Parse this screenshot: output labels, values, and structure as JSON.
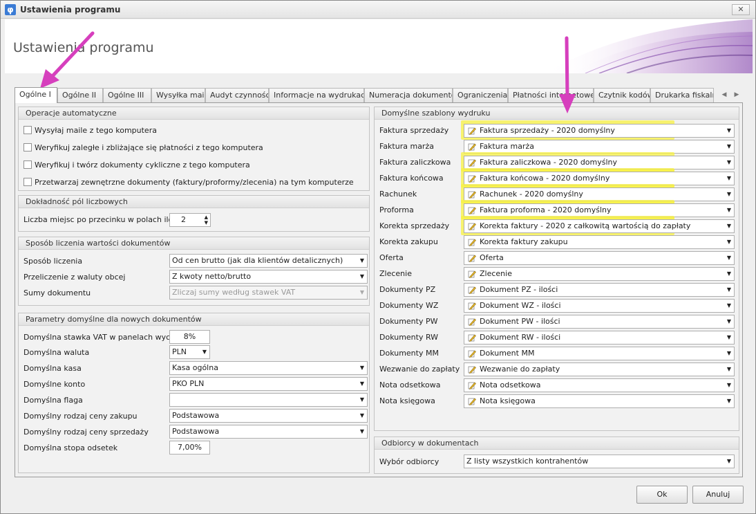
{
  "window": {
    "title": "Ustawienia programu",
    "close": "✕"
  },
  "header": {
    "title": "Ustawienia programu"
  },
  "tabs": [
    "Ogólne I",
    "Ogólne II",
    "Ogólne III",
    "Wysyłka maili",
    "Audyt czynności",
    "Informacje na wydrukach",
    "Numeracja dokumentów",
    "Ograniczenia",
    "Płatności internetowe",
    "Czytnik kodów",
    "Drukarka fiskaln"
  ],
  "active_tab": "Ogólne I",
  "auto_ops": {
    "title": "Operacje automatyczne",
    "items": [
      {
        "label": "Wysyłaj maile z tego komputera",
        "checked": false
      },
      {
        "label": "Weryfikuj zaległe i zbliżające się płatności z tego komputera",
        "checked": false
      },
      {
        "label": "Weryfikuj i twórz dokumenty cykliczne z tego komputera",
        "checked": false
      },
      {
        "label": "Przetwarzaj zewnętrzne dokumenty (faktury/proformy/zlecenia) na tym komputerze",
        "checked": false
      }
    ]
  },
  "precision": {
    "title": "Dokładność pól liczbowych",
    "label": "Liczba miejsc po przecinku w polach ilości",
    "value": "2"
  },
  "calc": {
    "title": "Sposób liczenia wartości dokumentów",
    "rows": [
      {
        "label": "Sposób liczenia",
        "value": "Od cen brutto (jak dla klientów detalicznych)",
        "disabled": false
      },
      {
        "label": "Przeliczenie z waluty obcej",
        "value": "Z kwoty netto/brutto",
        "disabled": false
      },
      {
        "label": "Sumy dokumentu",
        "value": "Zliczaj sumy według stawek VAT",
        "disabled": true
      }
    ]
  },
  "defaults": {
    "title": "Parametry domyślne dla nowych dokumentów",
    "vat_label": "Domyślna stawka VAT w panelach wycen",
    "vat_value": "8%",
    "currency_label": "Domyślna waluta",
    "currency_value": "PLN",
    "cashbox_label": "Domyślna kasa",
    "cashbox_value": "Kasa ogólna",
    "account_label": "Domyślne konto",
    "account_value": "PKO PLN",
    "flag_label": "Domyślna flaga",
    "flag_value": "",
    "purchase_price_label": "Domyślny rodzaj ceny zakupu",
    "purchase_price_value": "Podstawowa",
    "sale_price_label": "Domyślny rodzaj ceny sprzedaży",
    "sale_price_value": "Podstawowa",
    "interest_label": "Domyślna stopa odsetek",
    "interest_value": "7,00%"
  },
  "templates": {
    "title": "Domyślne szablony wydruku",
    "rows": [
      {
        "label": "Faktura sprzedaży",
        "value": "Faktura sprzedaży - 2020 domyślny",
        "highlight": true
      },
      {
        "label": "Faktura marża",
        "value": "Faktura marża",
        "highlight": false
      },
      {
        "label": "Faktura zaliczkowa",
        "value": "Faktura zaliczkowa - 2020 domyślny",
        "highlight": true
      },
      {
        "label": "Faktura końcowa",
        "value": "Faktura końcowa - 2020 domyślny",
        "highlight": true
      },
      {
        "label": "Rachunek",
        "value": "Rachunek - 2020 domyślny",
        "highlight": true
      },
      {
        "label": "Proforma",
        "value": "Faktura proforma - 2020 domyślny",
        "highlight": true
      },
      {
        "label": "Korekta sprzedaży",
        "value": "Korekta faktury - 2020 z całkowitą wartością do zapłaty",
        "highlight": true
      },
      {
        "label": "Korekta zakupu",
        "value": "Korekta faktury zakupu",
        "highlight": false
      },
      {
        "label": "Oferta",
        "value": "Oferta",
        "highlight": false
      },
      {
        "label": "Zlecenie",
        "value": "Zlecenie",
        "highlight": false
      },
      {
        "label": "Dokumenty PZ",
        "value": "Dokument PZ - ilości",
        "highlight": false
      },
      {
        "label": "Dokumenty WZ",
        "value": "Dokument WZ - ilości",
        "highlight": false
      },
      {
        "label": "Dokumenty PW",
        "value": "Dokument PW - ilości",
        "highlight": false
      },
      {
        "label": "Dokumenty RW",
        "value": "Dokument RW - ilości",
        "highlight": false
      },
      {
        "label": "Dokumenty MM",
        "value": "Dokument MM",
        "highlight": false
      },
      {
        "label": "Wezwanie do zapłaty",
        "value": "Wezwanie do zapłaty",
        "highlight": false
      },
      {
        "label": "Nota odsetkowa",
        "value": "Nota odsetkowa",
        "highlight": false
      },
      {
        "label": "Nota księgowa",
        "value": "Nota księgowa",
        "highlight": false
      }
    ]
  },
  "recipients": {
    "title": "Odbiorcy w dokumentach",
    "label": "Wybór odbiorcy",
    "value": "Z listy wszystkich kontrahentów"
  },
  "buttons": {
    "ok": "Ok",
    "cancel": "Anuluj"
  },
  "colors": {
    "highlight": "#f8f242",
    "annotation_arrow": "#d63fbd"
  }
}
